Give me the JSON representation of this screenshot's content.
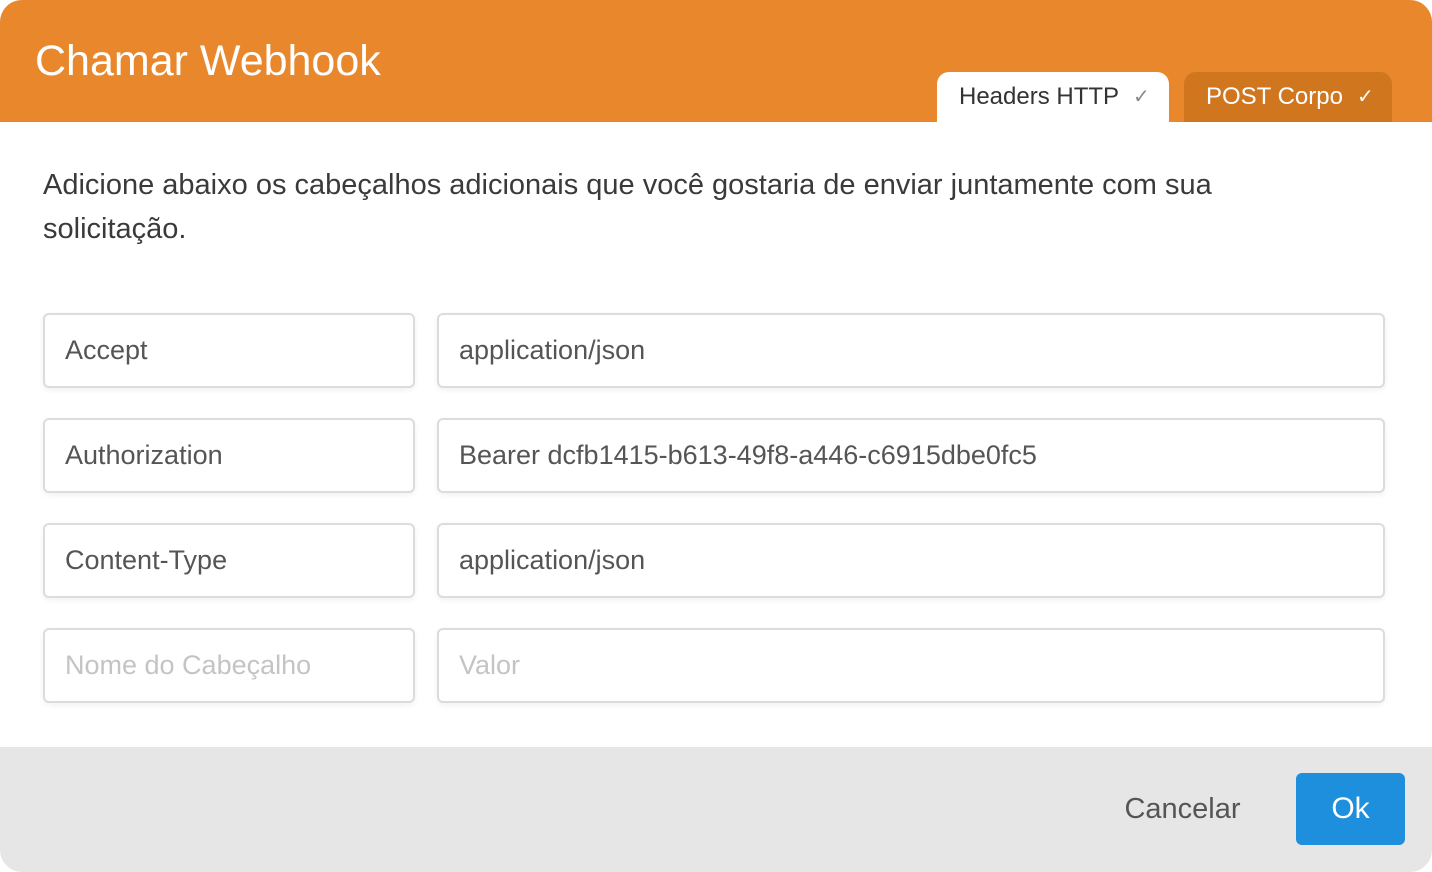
{
  "dialog": {
    "title": "Chamar Webhook",
    "tabs": [
      {
        "label": "Headers HTTP",
        "check": "✓",
        "active": true
      },
      {
        "label": "POST Corpo",
        "check": "✓",
        "active": false
      }
    ],
    "description": "Adicione abaixo os cabeçalhos adicionais que você gostaria de enviar juntamente com sua solicitação.",
    "headers": [
      {
        "name": "Accept",
        "value": "application/json"
      },
      {
        "name": "Authorization",
        "value": "Bearer dcfb1415-b613-49f8-a446-c6915dbe0fc5"
      },
      {
        "name": "Content-Type",
        "value": "application/json"
      }
    ],
    "new_header": {
      "name_placeholder": "Nome do Cabeçalho",
      "value_placeholder": "Valor"
    },
    "footer": {
      "cancel_label": "Cancelar",
      "ok_label": "Ok"
    }
  },
  "colors": {
    "header_bg": "#E8872B",
    "inactive_tab_bg": "#D0761F",
    "ok_button_bg": "#1E8FDC",
    "footer_bg": "#E6E6E6"
  }
}
